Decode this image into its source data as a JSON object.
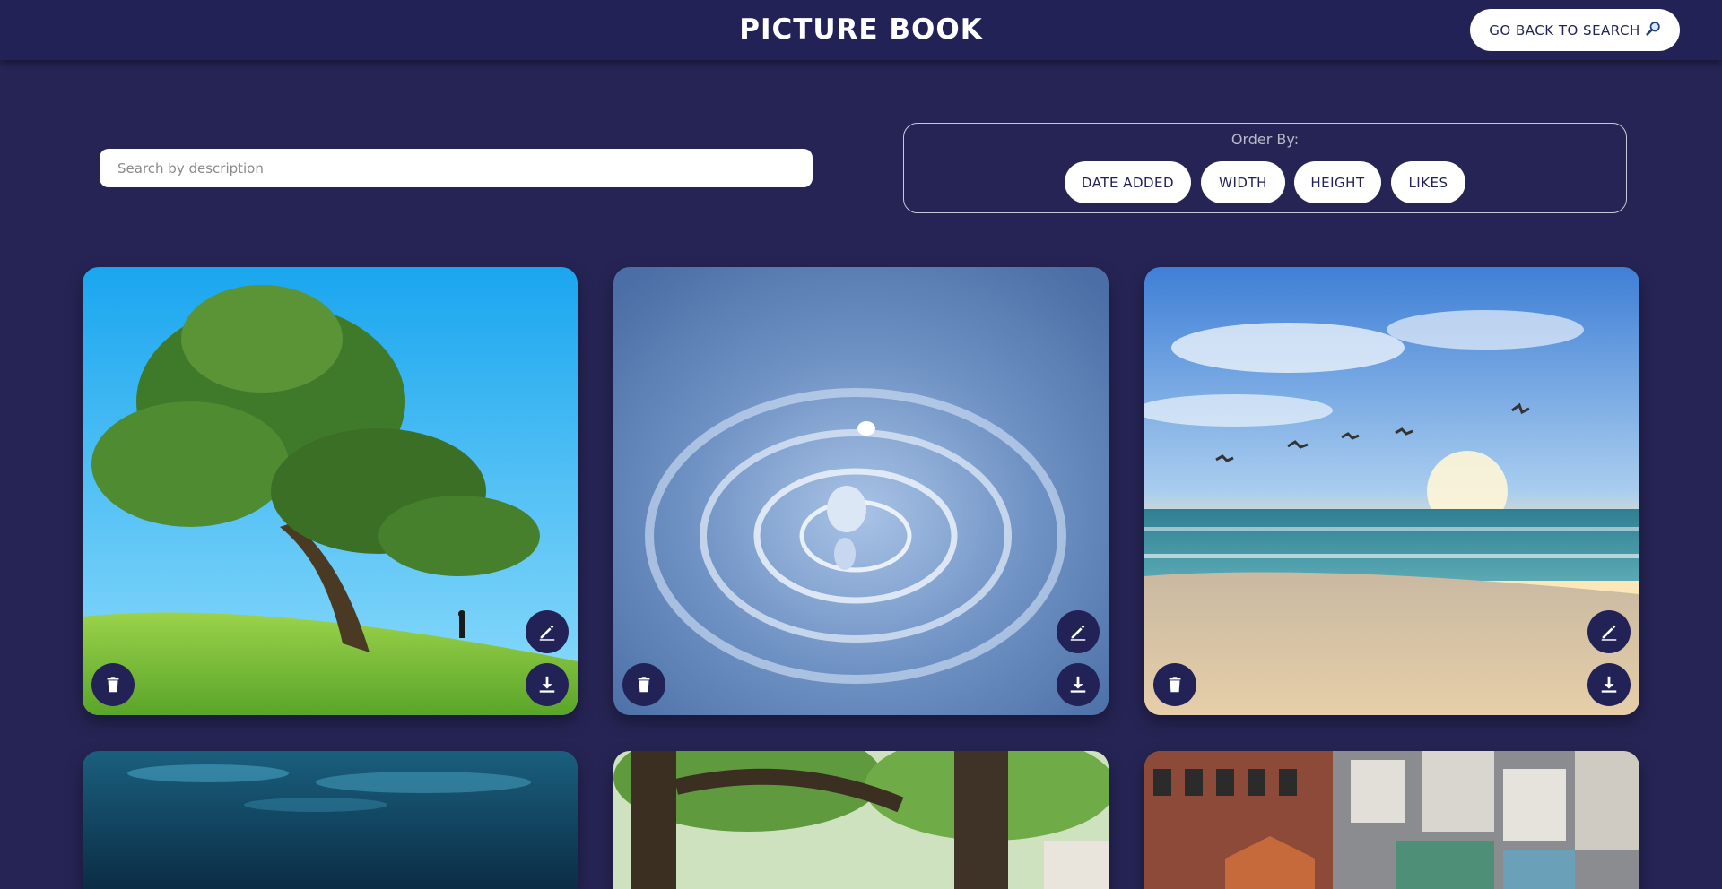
{
  "header": {
    "title": "PICTURE BOOK",
    "back_button_label": "GO BACK TO SEARCH",
    "back_button_icon": "magnifier-icon"
  },
  "search": {
    "placeholder": "Search by description",
    "value": ""
  },
  "order_by": {
    "label": "Order By:",
    "options": [
      "DATE ADDED",
      "WIDTH",
      "HEIGHT",
      "LIKES"
    ]
  },
  "cards": [
    {
      "photo": "tree-on-grassy-hill",
      "actions": [
        "edit-icon",
        "trash-icon",
        "download-icon"
      ]
    },
    {
      "photo": "water-droplet-ripples",
      "actions": [
        "edit-icon",
        "trash-icon",
        "download-icon"
      ]
    },
    {
      "photo": "beach-sunset-with-seagulls",
      "actions": [
        "edit-icon",
        "trash-icon",
        "download-icon"
      ]
    },
    {
      "photo": "underwater-surface",
      "actions": []
    },
    {
      "photo": "forest-tree-canopy",
      "actions": []
    },
    {
      "photo": "city-rooftops-aerial",
      "actions": []
    }
  ],
  "colors": {
    "background": "#262454",
    "header": "#222257",
    "button_bg": "#ffffff",
    "icon_button_bg": "#222257"
  }
}
